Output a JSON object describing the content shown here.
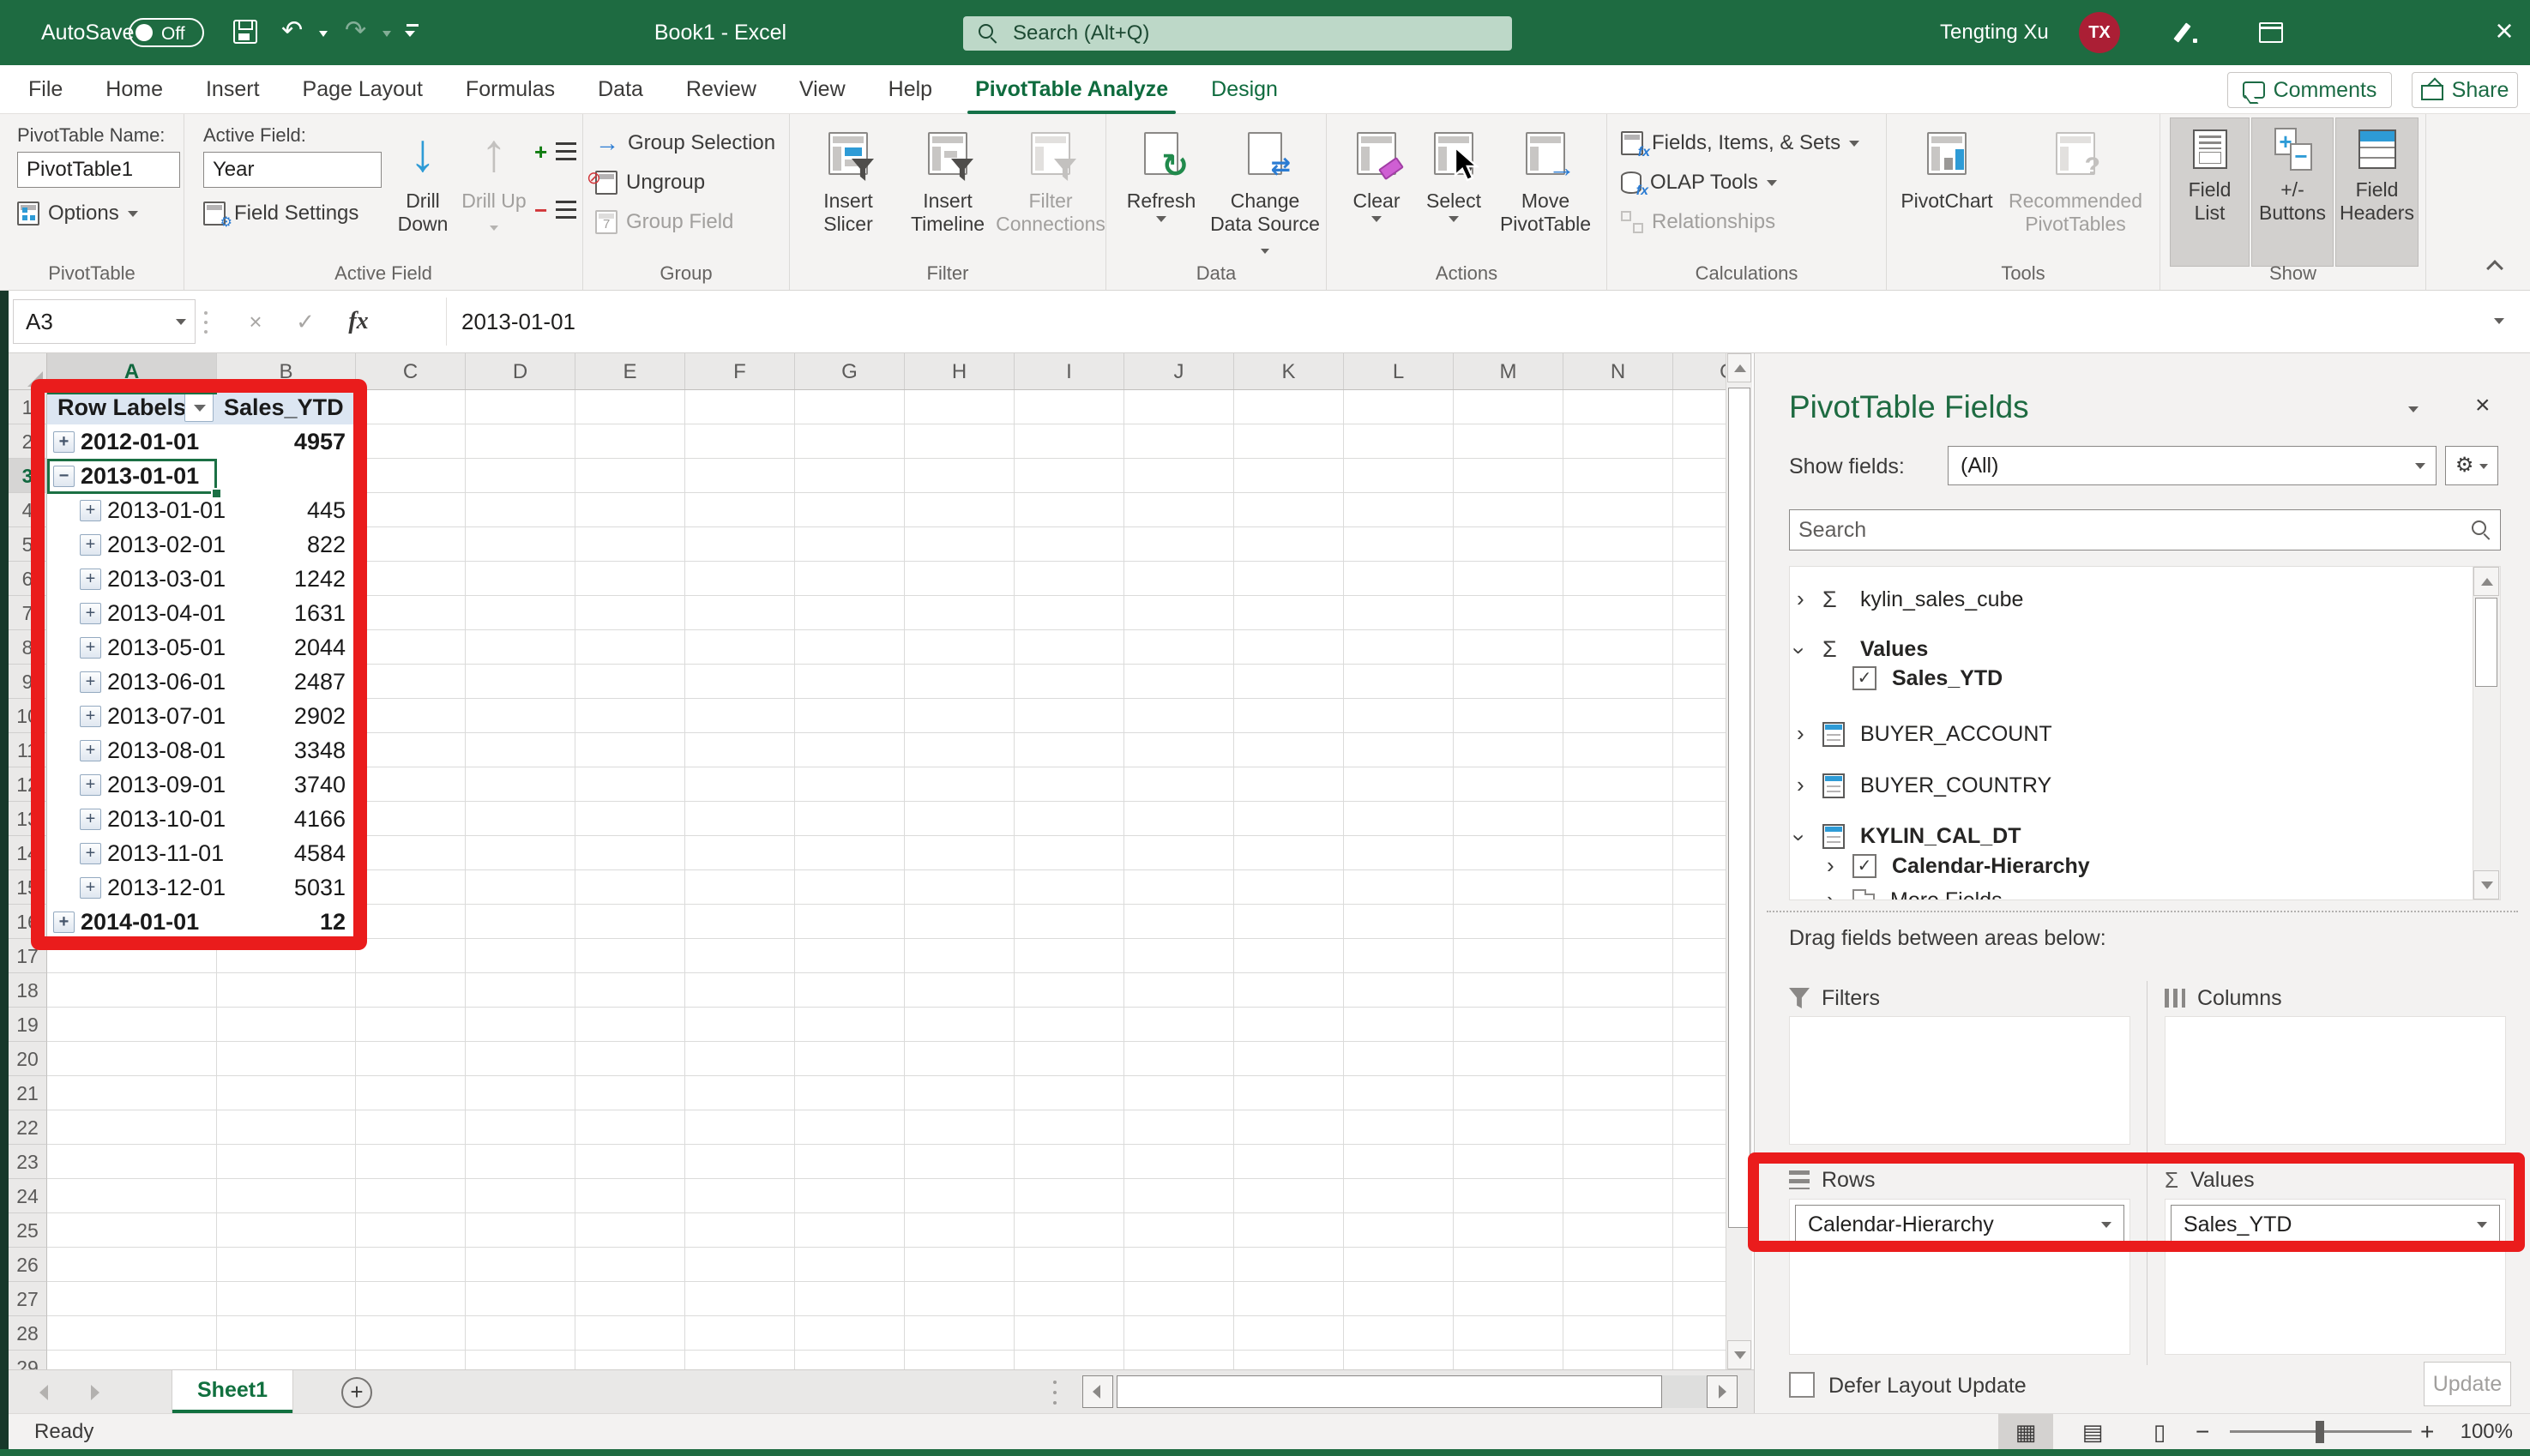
{
  "title_bar": {
    "autosave_label": "AutoSave",
    "autosave_state": "Off",
    "document_title": "Book1 - Excel",
    "search_placeholder": "Search (Alt+Q)",
    "user_name": "Tengting Xu",
    "user_initials": "TX"
  },
  "ribbon_tabs": {
    "items": [
      {
        "label": "File"
      },
      {
        "label": "Home"
      },
      {
        "label": "Insert"
      },
      {
        "label": "Page Layout"
      },
      {
        "label": "Formulas"
      },
      {
        "label": "Data"
      },
      {
        "label": "Review"
      },
      {
        "label": "View"
      },
      {
        "label": "Help"
      },
      {
        "label": "PivotTable Analyze",
        "active": true
      },
      {
        "label": "Design",
        "contextual": true
      }
    ],
    "comments": "Comments",
    "share": "Share"
  },
  "ribbon": {
    "pivottable": {
      "caption": "PivotTable",
      "name_label": "PivotTable Name:",
      "name_value": "PivotTable1",
      "options": "Options"
    },
    "active_field": {
      "caption": "Active Field",
      "label": "Active Field:",
      "value": "Year",
      "field_settings": "Field Settings",
      "drill_down": "Drill Down",
      "drill_up": "Drill Up"
    },
    "group": {
      "caption": "Group",
      "selection": "Group Selection",
      "ungroup": "Ungroup",
      "group_field": "Group Field"
    },
    "filter": {
      "caption": "Filter",
      "insert_slicer": "Insert Slicer",
      "insert_timeline": "Insert Timeline",
      "filter_connections": "Filter Connections"
    },
    "data": {
      "caption": "Data",
      "refresh": "Refresh",
      "change_source": "Change Data Source"
    },
    "actions": {
      "caption": "Actions",
      "clear": "Clear",
      "select": "Select",
      "move": "Move PivotTable"
    },
    "calculations": {
      "caption": "Calculations",
      "fields_items_sets": "Fields, Items, & Sets",
      "olap_tools": "OLAP Tools",
      "relationships": "Relationships"
    },
    "tools": {
      "caption": "Tools",
      "pivotchart": "PivotChart",
      "recommended": "Recommended PivotTables"
    },
    "show": {
      "caption": "Show",
      "field_list": "Field List",
      "plus_minus": "+/- Buttons",
      "field_headers": "Field Headers"
    }
  },
  "formula_bar": {
    "name_box": "A3",
    "fx": "fx",
    "formula": "2013-01-01"
  },
  "grid": {
    "columns": [
      "A",
      "B",
      "C",
      "D",
      "E",
      "F",
      "G",
      "H",
      "I",
      "J",
      "K",
      "L",
      "M",
      "N",
      "O"
    ],
    "row_count": 29,
    "selected_cell": "A3",
    "selected_column": "A",
    "selected_row": 3
  },
  "pivot": {
    "headers": {
      "rows": "Row Labels",
      "values": "Sales_YTD"
    },
    "rows": [
      {
        "label": "2012-01-01",
        "value": "4957",
        "level": 0,
        "expander": "plus",
        "bold": true
      },
      {
        "label": "2013-01-01",
        "value": "",
        "level": 0,
        "expander": "minus",
        "bold": true,
        "selected": true
      },
      {
        "label": "2013-01-01",
        "value": "445",
        "level": 1,
        "expander": "plus"
      },
      {
        "label": "2013-02-01",
        "value": "822",
        "level": 1,
        "expander": "plus"
      },
      {
        "label": "2013-03-01",
        "value": "1242",
        "level": 1,
        "expander": "plus"
      },
      {
        "label": "2013-04-01",
        "value": "1631",
        "level": 1,
        "expander": "plus"
      },
      {
        "label": "2013-05-01",
        "value": "2044",
        "level": 1,
        "expander": "plus"
      },
      {
        "label": "2013-06-01",
        "value": "2487",
        "level": 1,
        "expander": "plus"
      },
      {
        "label": "2013-07-01",
        "value": "2902",
        "level": 1,
        "expander": "plus"
      },
      {
        "label": "2013-08-01",
        "value": "3348",
        "level": 1,
        "expander": "plus"
      },
      {
        "label": "2013-09-01",
        "value": "3740",
        "level": 1,
        "expander": "plus"
      },
      {
        "label": "2013-10-01",
        "value": "4166",
        "level": 1,
        "expander": "plus"
      },
      {
        "label": "2013-11-01",
        "value": "4584",
        "level": 1,
        "expander": "plus"
      },
      {
        "label": "2013-12-01",
        "value": "5031",
        "level": 1,
        "expander": "plus"
      },
      {
        "label": "2014-01-01",
        "value": "12",
        "level": 0,
        "expander": "plus",
        "bold": true
      }
    ]
  },
  "fields_pane": {
    "title": "PivotTable Fields",
    "show_fields_label": "Show fields:",
    "show_fields_value": "(All)",
    "search_placeholder": "Search",
    "tree": [
      {
        "label": "kylin_sales_cube",
        "icon": "sigma",
        "expander": "collapsed"
      },
      {
        "label": "Values",
        "icon": "sigma",
        "expander": "expanded",
        "bold": true
      },
      {
        "label": "Sales_YTD",
        "checkbox": true,
        "checked": true,
        "bold": true,
        "indent": 1
      },
      {
        "label": "BUYER_ACCOUNT",
        "icon": "table",
        "expander": "collapsed"
      },
      {
        "label": "BUYER_COUNTRY",
        "icon": "table",
        "expander": "collapsed"
      },
      {
        "label": "KYLIN_CAL_DT",
        "icon": "table",
        "expander": "expanded",
        "bold": true
      },
      {
        "label": "Calendar-Hierarchy",
        "checkbox": true,
        "checked": true,
        "bold": true,
        "indent": 1,
        "expander": "collapsed"
      },
      {
        "label": "More Fields",
        "icon": "folder",
        "indent": 1,
        "expander": "collapsed"
      }
    ],
    "drag_label": "Drag fields between areas below:",
    "areas": {
      "filters": {
        "label": "Filters",
        "items": []
      },
      "columns": {
        "label": "Columns",
        "items": []
      },
      "rows": {
        "label": "Rows",
        "items": [
          "Calendar-Hierarchy"
        ]
      },
      "values": {
        "label": "Values",
        "items": [
          "Sales_YTD"
        ]
      }
    },
    "defer_label": "Defer Layout Update",
    "update_label": "Update"
  },
  "sheet_bar": {
    "sheet_name": "Sheet1"
  },
  "status_bar": {
    "ready": "Ready",
    "zoom_level": "100%"
  },
  "colors": {
    "excel_green": "#1e6b41",
    "accent_green": "#217346",
    "selection_green": "#1b7044",
    "annotation_red": "#ea1c1c",
    "pivot_header_fill": "#dce6f2",
    "icon_blue": "#2e9bd6"
  }
}
